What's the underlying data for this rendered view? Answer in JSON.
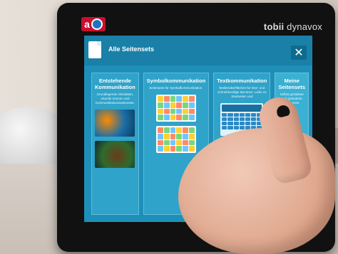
{
  "brand": {
    "logo_text": "a",
    "name_prefix": "tobii",
    "name_suffix": "dynavox"
  },
  "screen": {
    "title": "Alle Seitensets",
    "close_label": "✕",
    "cards": [
      {
        "title": "Entstehende Kommunikation",
        "desc": "Grundlegende Aktivitäten, visuelle Szenen und Kommunikationsseitensets."
      },
      {
        "title": "Symbolkommunikation",
        "desc": "Seitensets für Symbolkommunikation."
      },
      {
        "title": "Textkommunikation",
        "desc": "Bedienoberflächen für lese- und schreibkundige Benutzer. Links zu Startseiten und"
      },
      {
        "title": "Meine Seitensets",
        "desc": "Selbst gestaltete und geänderte Seitensets."
      }
    ]
  }
}
